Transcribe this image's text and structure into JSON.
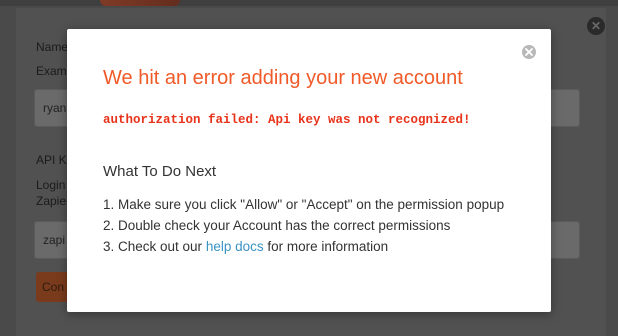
{
  "background": {
    "name_label": "Name",
    "name_hint": "Exam",
    "name_value": "ryan",
    "api_key_label": "API Ke",
    "api_key_hint_1": "Login",
    "api_key_hint_2": "Zapier",
    "api_key_value": "zapi",
    "continue_button": "Con",
    "close_icon": "close-icon"
  },
  "modal": {
    "title": "We hit an error adding your new account",
    "error_detail": "authorization failed: Api key was not recognized!",
    "next_heading": "What To Do Next",
    "steps": [
      "1. Make sure you click \"Allow\" or \"Accept\" on the permission popup",
      "2. Double check your Account has the correct permissions"
    ],
    "step3_prefix": "3. Check out our ",
    "step3_link": "help docs",
    "step3_suffix": " for more information",
    "close_icon": "close-circle-icon"
  },
  "colors": {
    "accent": "#f05a28",
    "error": "#e8331b",
    "link": "#3b93c4",
    "overlay": "#4a4a4a"
  }
}
